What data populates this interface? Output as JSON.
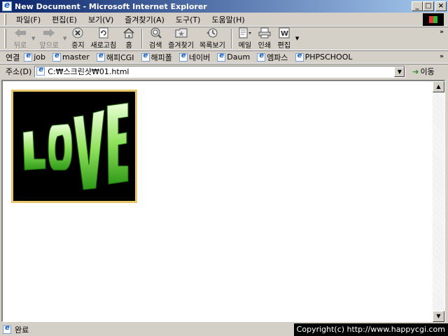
{
  "window": {
    "title": "New Document - Microsoft Internet Explorer",
    "minimize_label": "_",
    "maximize_label": "□",
    "close_label": "×"
  },
  "menubar": {
    "items": [
      {
        "label": "파일(F)"
      },
      {
        "label": "편집(E)"
      },
      {
        "label": "보기(V)"
      },
      {
        "label": "즐겨찾기(A)"
      },
      {
        "label": "도구(T)"
      },
      {
        "label": "도움말(H)"
      }
    ]
  },
  "toolbar": {
    "back": "뒤로",
    "forward": "앞으로",
    "stop": "중지",
    "refresh": "새로고침",
    "home": "홈",
    "search": "검색",
    "favorites": "즐겨찾기",
    "history": "목록보기",
    "mail": "메일",
    "print": "인쇄",
    "edit": "편집",
    "more": "»"
  },
  "links": {
    "label": "연결",
    "items": [
      {
        "label": "job"
      },
      {
        "label": "master"
      },
      {
        "label": "해피CGI"
      },
      {
        "label": "해피폴"
      },
      {
        "label": "네이버"
      },
      {
        "label": "Daum"
      },
      {
        "label": "엠파스"
      },
      {
        "label": "PHPSCHOOL"
      }
    ],
    "more": "»"
  },
  "address": {
    "label": "주소(D)",
    "value": "C:₩스크린샷₩01.html",
    "go_label": "이동"
  },
  "page": {
    "image_text": "LOVE"
  },
  "status": {
    "text": "완료",
    "copyright": "Copyright(c) http://www.happycgi.com"
  },
  "colors": {
    "titlebar_start": "#0a246a",
    "titlebar_end": "#a6caf0",
    "chrome": "#d4d0c8",
    "image_border": "#e8c66a",
    "love_green": "#5fd13a"
  }
}
